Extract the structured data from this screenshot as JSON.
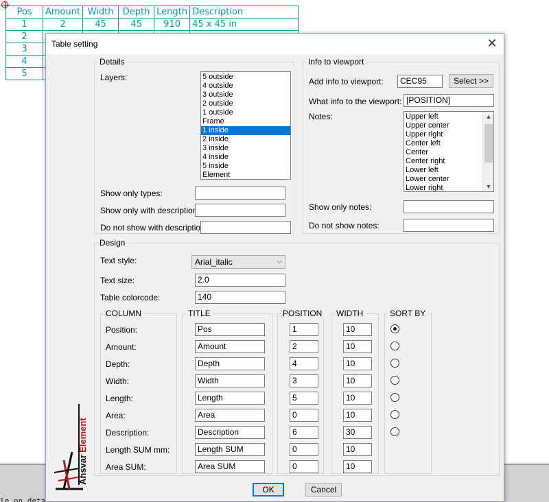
{
  "background_table": {
    "headers": [
      "Pos",
      "Amount",
      "Width",
      "Depth",
      "Length",
      "Description"
    ],
    "rows": [
      [
        "1",
        "2",
        "45",
        "45",
        "910",
        "45 x 45 in"
      ],
      [
        "2",
        "",
        "",
        "",
        "",
        ""
      ],
      [
        "3",
        "",
        "",
        "",
        "",
        ""
      ],
      [
        "4",
        "",
        "",
        "",
        "",
        ""
      ],
      [
        "5",
        "",
        "",
        "",
        "",
        ""
      ]
    ]
  },
  "command_line": "le on detail table:",
  "dialog": {
    "title": "Table setting",
    "details": {
      "group_label": "Details",
      "layers_label": "Layers:",
      "layers": [
        "5 outside",
        "4 outside",
        "3 outside",
        "2 outside",
        "1 outside",
        "Frame",
        "1 inside",
        "2 inside",
        "3 inside",
        "4 inside",
        "5 inside",
        "Element"
      ],
      "selected_layer": "1 inside",
      "show_only_types_label": "Show only types:",
      "show_only_types_value": "",
      "show_only_with_desc_label": "Show only with description:",
      "show_only_with_desc_value": "",
      "do_not_show_with_desc_label": "Do not show with description:",
      "do_not_show_with_desc_value": ""
    },
    "viewport": {
      "group_label": "Info to viewport",
      "add_info_label": "Add info to viewport:",
      "add_info_value": "CEC95",
      "select_button": "Select >>",
      "what_info_label": "What info to the viewport:",
      "what_info_value": "[POSITION]",
      "notes_label": "Notes:",
      "notes": [
        "Upper left",
        "Upper center",
        "Upper right",
        "Center left",
        "Center",
        "Center right",
        "Lower left",
        "Lower center",
        "Lower right"
      ],
      "show_only_notes_label": "Show only notes:",
      "show_only_notes_value": "",
      "do_not_show_notes_label": "Do not show notes:",
      "do_not_show_notes_value": ""
    },
    "design": {
      "group_label": "Design",
      "text_style_label": "Text style:",
      "text_style_value": "Arial_italic",
      "text_size_label": "Text size:",
      "text_size_value": "2.0",
      "colorcode_label": "Table colorcode:",
      "colorcode_value": "140",
      "headers": {
        "column": "COLUMN",
        "title": "TITLE",
        "position": "POSITION",
        "width": "WIDTH",
        "sort_by": "SORT BY"
      },
      "rows": [
        {
          "column": "Position:",
          "title": "Pos",
          "position": "1",
          "width": "10",
          "sort": true
        },
        {
          "column": "Amount:",
          "title": "Amount",
          "position": "2",
          "width": "10",
          "sort": false
        },
        {
          "column": "Depth:",
          "title": "Depth",
          "position": "4",
          "width": "10",
          "sort": false
        },
        {
          "column": "Width:",
          "title": "Width",
          "position": "3",
          "width": "10",
          "sort": false
        },
        {
          "column": "Length:",
          "title": "Length",
          "position": "5",
          "width": "10",
          "sort": false
        },
        {
          "column": "Area:",
          "title": "Area",
          "position": "0",
          "width": "10",
          "sort": false
        },
        {
          "column": "Description:",
          "title": "Description",
          "position": "6",
          "width": "30",
          "sort": false
        },
        {
          "column": "Length SUM mm:",
          "title": "Length SUM",
          "position": "0",
          "width": "10",
          "sort": null
        },
        {
          "column": "Area SUM:",
          "title": "Area SUM",
          "position": "0",
          "width": "10",
          "sort": null
        }
      ]
    },
    "ok_button": "OK",
    "cancel_button": "Cancel",
    "logo_text_a": "Ansvar",
    "logo_text_b": "Element"
  },
  "colors": {
    "accent_selection": "#0078d7",
    "cad_table": "#00a0b0",
    "logo_red": "#c0141c"
  }
}
